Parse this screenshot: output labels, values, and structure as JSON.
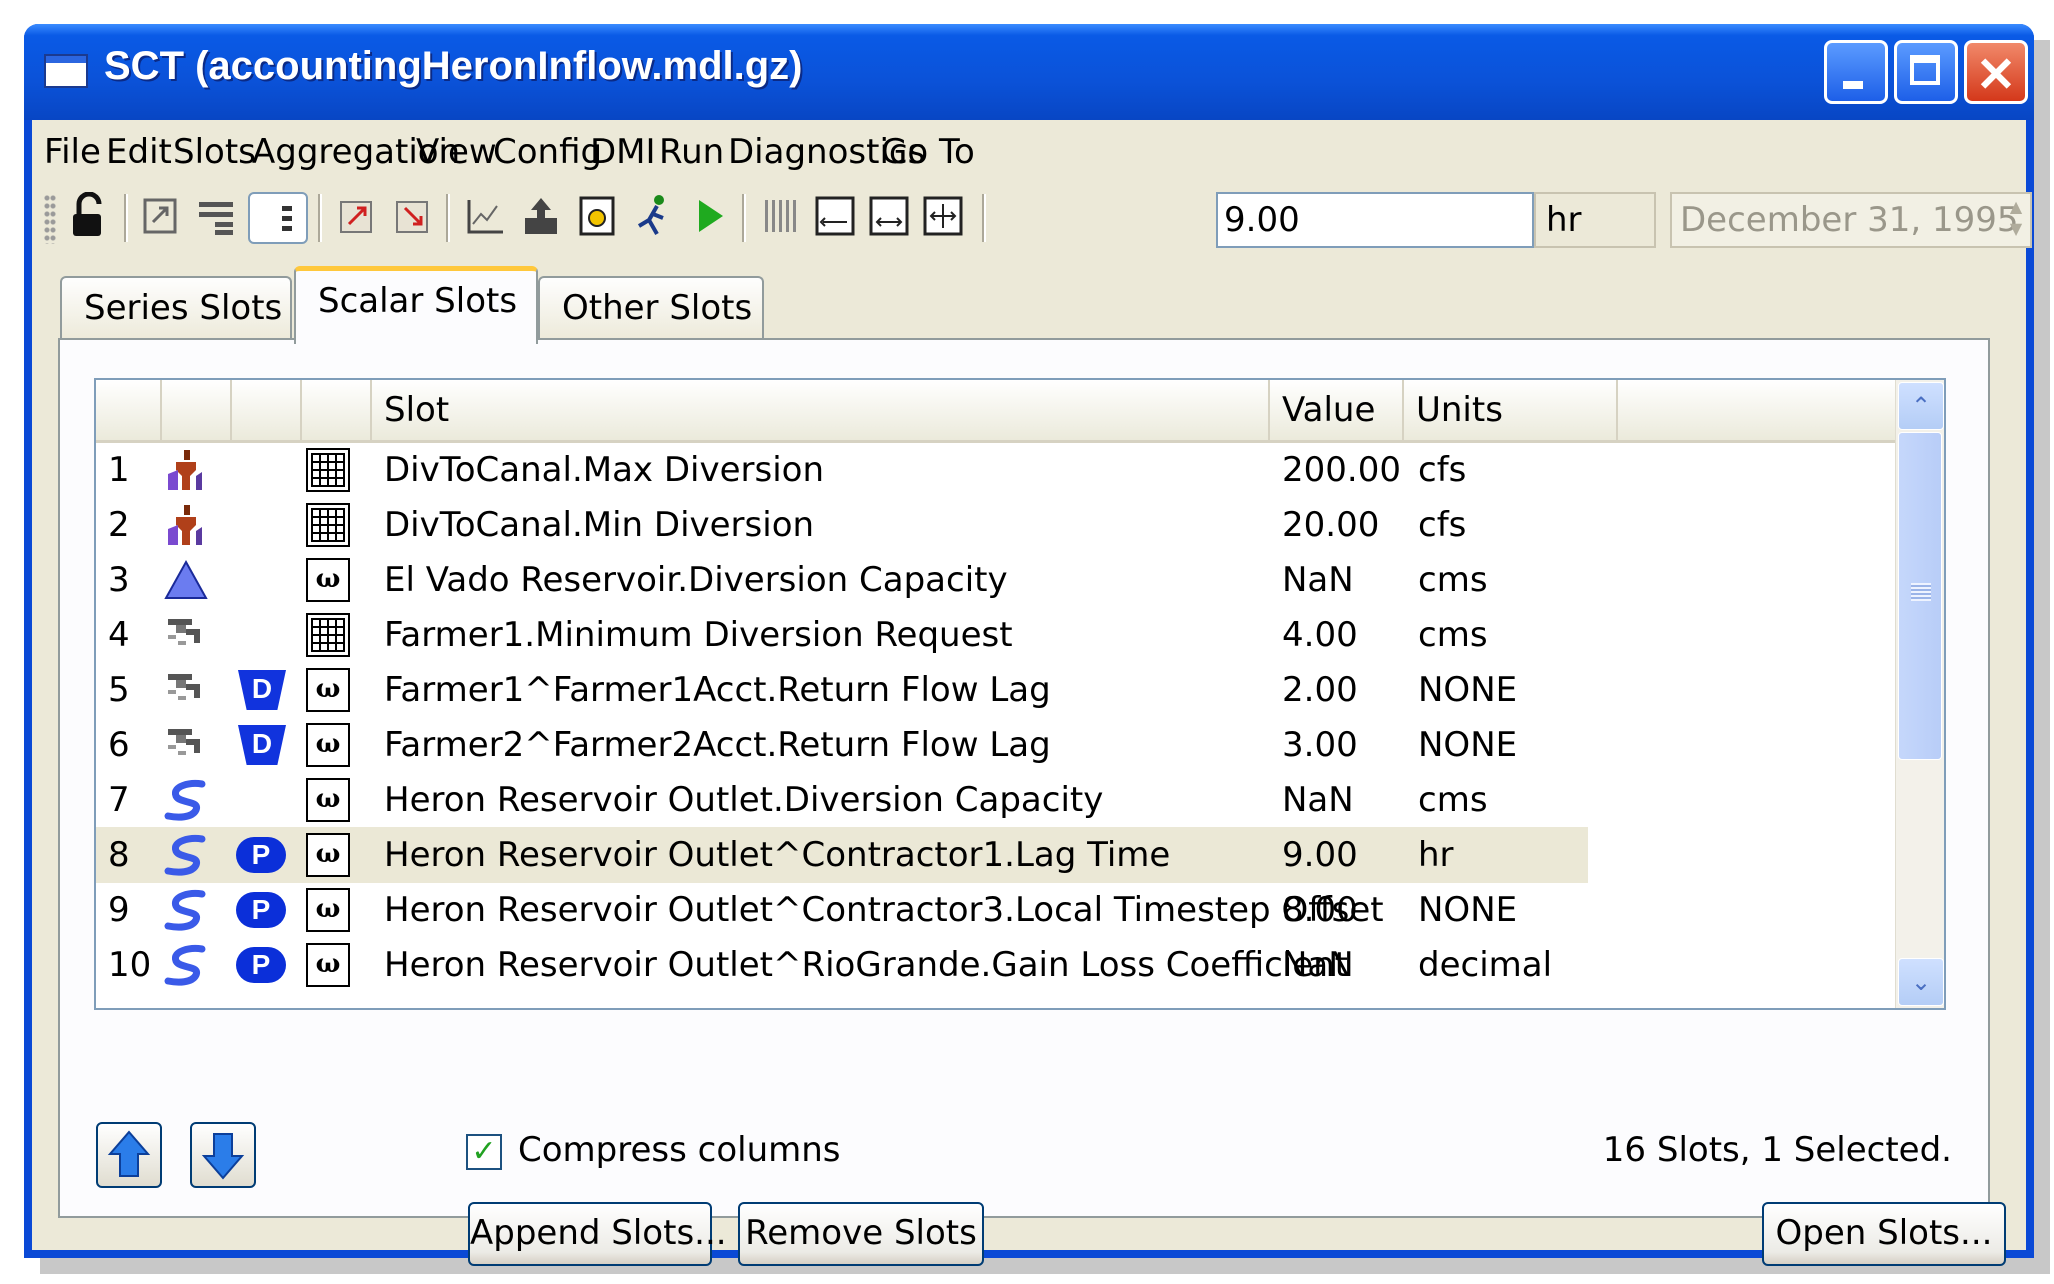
{
  "window": {
    "title": "SCT  (accountingHeronInflow.mdl.gz)"
  },
  "menu": [
    "File",
    "Edit",
    "Slots",
    "Aggregation",
    "View",
    "Config",
    "DMI",
    "Run",
    "Diagnostics",
    "Go To"
  ],
  "toolbar": {
    "icons": [
      "lock-icon",
      "reorder-icon",
      "filter-icon",
      "list-view-icon",
      "open-export-icon",
      "close-export-icon",
      "plot-icon",
      "upload-icon",
      "timestep-icon",
      "run-man-icon",
      "play-icon",
      "columns-icon",
      "fit-width-icon",
      "fit-icon",
      "expand-icon"
    ],
    "value_input": "9.00",
    "unit": "hr",
    "date": "December 31, 1995"
  },
  "tabs": [
    "Series Slots",
    "Scalar Slots",
    "Other Slots"
  ],
  "active_tab": "Scalar Slots",
  "table": {
    "columns": [
      "Slot",
      "Value",
      "Units"
    ],
    "rows": [
      {
        "num": "1",
        "icon": "diversion-icon",
        "badge": "",
        "type": "table-slot-icon",
        "slot": "DivToCanal.Max Diversion",
        "value": "200.00",
        "units": "cfs"
      },
      {
        "num": "2",
        "icon": "diversion-icon",
        "badge": "",
        "type": "table-slot-icon",
        "slot": "DivToCanal.Min Diversion",
        "value": "20.00",
        "units": "cfs"
      },
      {
        "num": "3",
        "icon": "reservoir-icon",
        "badge": "",
        "type": "scalar-slot-icon",
        "slot": "El Vado Reservoir.Diversion Capacity",
        "value": "NaN",
        "units": "cms"
      },
      {
        "num": "4",
        "icon": "water-user-icon",
        "badge": "",
        "type": "table-slot-icon",
        "slot": "Farmer1.Minimum Diversion Request",
        "value": "4.00",
        "units": "cms"
      },
      {
        "num": "5",
        "icon": "water-user-icon",
        "badge": "D",
        "type": "scalar-slot-icon",
        "slot": "Farmer1^Farmer1Acct.Return Flow Lag",
        "value": "2.00",
        "units": "NONE"
      },
      {
        "num": "6",
        "icon": "water-user-icon",
        "badge": "D",
        "type": "scalar-slot-icon",
        "slot": "Farmer2^Farmer2Acct.Return Flow Lag",
        "value": "3.00",
        "units": "NONE"
      },
      {
        "num": "7",
        "icon": "reach-icon",
        "badge": "",
        "type": "scalar-slot-icon",
        "slot": "Heron Reservoir Outlet.Diversion Capacity",
        "value": "NaN",
        "units": "cms"
      },
      {
        "num": "8",
        "icon": "reach-icon",
        "badge": "P",
        "type": "scalar-slot-icon",
        "slot": "Heron Reservoir Outlet^Contractor1.Lag Time",
        "value": "9.00",
        "units": "hr"
      },
      {
        "num": "9",
        "icon": "reach-icon",
        "badge": "P",
        "type": "scalar-slot-icon",
        "slot": "Heron Reservoir Outlet^Contractor3.Local Timestep Offset",
        "value": "8.00",
        "units": "NONE"
      },
      {
        "num": "10",
        "icon": "reach-icon",
        "badge": "P",
        "type": "scalar-slot-icon",
        "slot": "Heron Reservoir Outlet^RioGrande.Gain Loss Coefficient",
        "value": "NaN",
        "units": "decimal"
      }
    ],
    "selected_row": "8"
  },
  "compress": {
    "label": "Compress columns",
    "checked": true
  },
  "status": "16 Slots, 1 Selected.",
  "buttons": {
    "append": "Append Slots...",
    "remove": "Remove Slots",
    "open": "Open Slots..."
  },
  "colors": {
    "title_blue": "#0b52d8",
    "selection": "#ebe8d6",
    "badge_blue": "#0b2fd9"
  }
}
